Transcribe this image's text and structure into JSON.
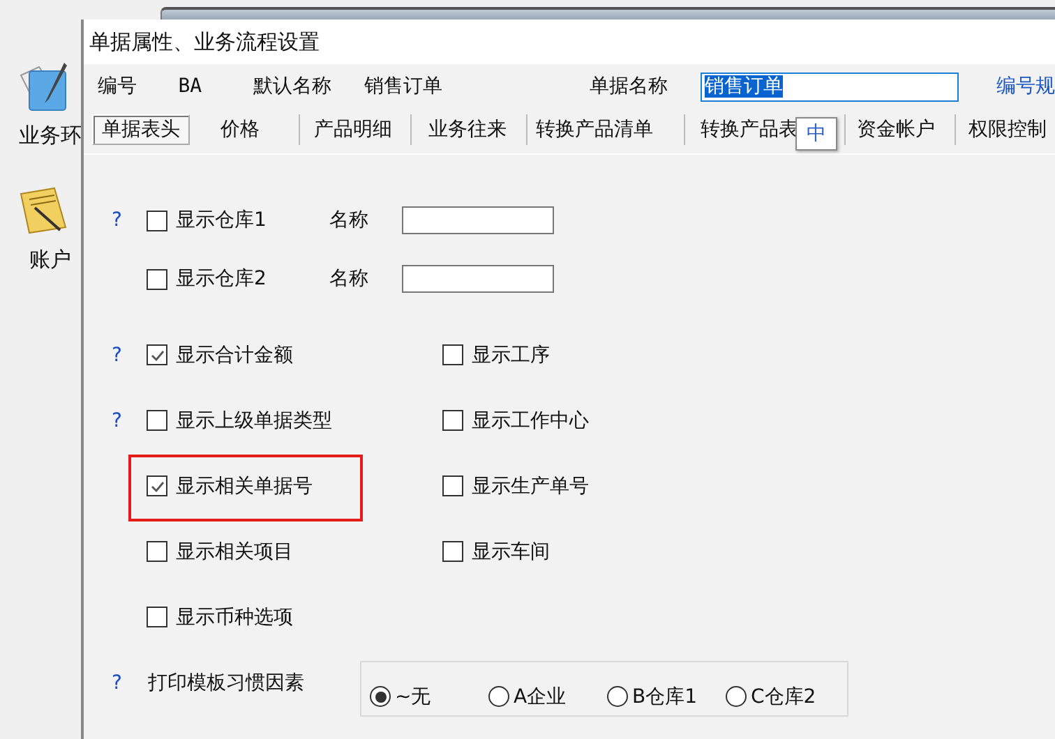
{
  "desktop_icons": [
    {
      "kind": "notepad",
      "label": "业务环"
    },
    {
      "kind": "document",
      "label": "账户"
    }
  ],
  "dialog": {
    "title": "单据属性、业务流程设置",
    "header": {
      "code_label": "编号",
      "code_value": "BA",
      "default_name_label": "默认名称",
      "default_name_value": "销售订单",
      "doc_name_label": "单据名称",
      "doc_name_value": "销售订单",
      "rule_link": "编号规"
    },
    "tabs": [
      {
        "label": "单据表头",
        "selected": true
      },
      {
        "label": "价格",
        "selected": false
      },
      {
        "label": "产品明细",
        "selected": false
      },
      {
        "label": "业务往来",
        "selected": false
      },
      {
        "label": "转换产品清单",
        "selected": false
      },
      {
        "label": "转换产品表",
        "selected": false
      },
      {
        "label": "资金帐户",
        "selected": false
      },
      {
        "label": "权限控制",
        "selected": false
      }
    ],
    "ime_indicator": "中",
    "rows": [
      {
        "help": "?",
        "items": [
          {
            "kind": "checkbox",
            "label": "显示仓库1",
            "checked": false,
            "highlighted": false
          },
          {
            "kind": "name-field",
            "label": "名称"
          }
        ]
      },
      {
        "items": [
          {
            "kind": "checkbox",
            "label": "显示仓库2",
            "checked": false,
            "highlighted": false
          },
          {
            "kind": "name-field",
            "label": "名称"
          }
        ]
      },
      {
        "help": "?",
        "items": [
          {
            "kind": "checkbox",
            "label": "显示合计金额",
            "checked": true,
            "highlighted": false
          },
          {
            "kind": "checkbox",
            "label": "显示工序",
            "checked": false,
            "highlighted": false
          }
        ]
      },
      {
        "help": "?",
        "items": [
          {
            "kind": "checkbox",
            "label": "显示上级单据类型",
            "checked": false,
            "highlighted": false
          },
          {
            "kind": "checkbox",
            "label": "显示工作中心",
            "checked": false,
            "highlighted": false
          }
        ]
      },
      {
        "items": [
          {
            "kind": "checkbox",
            "label": "显示相关单据号",
            "checked": true,
            "highlighted": true
          },
          {
            "kind": "checkbox",
            "label": "显示生产单号",
            "checked": false,
            "highlighted": false
          }
        ]
      },
      {
        "items": [
          {
            "kind": "checkbox",
            "label": "显示相关项目",
            "checked": false,
            "highlighted": false
          },
          {
            "kind": "checkbox",
            "label": "显示车间",
            "checked": false,
            "highlighted": false
          }
        ]
      },
      {
        "items": [
          {
            "kind": "checkbox",
            "label": "显示币种选项",
            "checked": false,
            "highlighted": false
          }
        ]
      },
      {
        "help": "?",
        "items": [
          {
            "kind": "radio-group",
            "label": "打印模板习惯因素",
            "options": [
              {
                "label": "~无",
                "selected": true
              },
              {
                "label": "A企业",
                "selected": false
              },
              {
                "label": "B仓库1",
                "selected": false
              },
              {
                "label": "C仓库2",
                "selected": false
              }
            ]
          }
        ]
      }
    ]
  }
}
